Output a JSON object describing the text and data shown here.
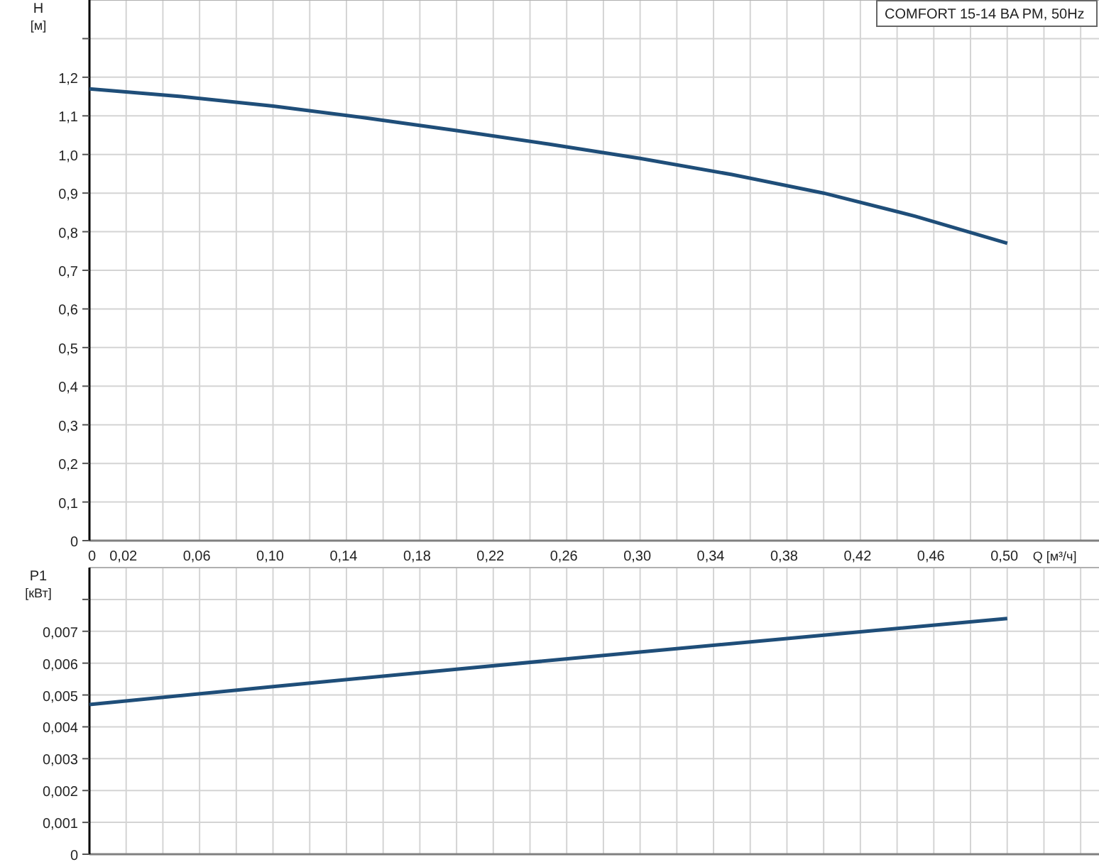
{
  "head_chart": {
    "unit": "[м]",
    "chart_data": {
      "type": "line",
      "grid": true,
      "ylabel": "H",
      "xlabel": "Q [м³/ч]",
      "x": [
        0,
        0.05,
        0.1,
        0.15,
        0.2,
        0.25,
        0.3,
        0.35,
        0.4,
        0.45,
        0.5
      ],
      "series": [
        {
          "name": "COMFORT 15-14 BA PM, 50Hz",
          "color": "#1f4e79",
          "values": [
            1.17,
            1.15,
            1.125,
            1.095,
            1.062,
            1.027,
            0.99,
            0.948,
            0.9,
            0.84,
            0.77
          ]
        }
      ],
      "xlim": [
        0,
        0.55
      ],
      "ylim": [
        0,
        1.4
      ],
      "xticks": [
        {
          "value": 0,
          "label": "0"
        },
        {
          "value": 0.02,
          "label": "0,02"
        },
        {
          "value": 0.06,
          "label": "0,06"
        },
        {
          "value": 0.1,
          "label": "0,10"
        },
        {
          "value": 0.14,
          "label": "0,14"
        },
        {
          "value": 0.18,
          "label": "0,18"
        },
        {
          "value": 0.22,
          "label": "0,22"
        },
        {
          "value": 0.26,
          "label": "0,26"
        },
        {
          "value": 0.3,
          "label": "0,30"
        },
        {
          "value": 0.34,
          "label": "0,34"
        },
        {
          "value": 0.38,
          "label": "0,38"
        },
        {
          "value": 0.42,
          "label": "0,42"
        },
        {
          "value": 0.46,
          "label": "0,46"
        },
        {
          "value": 0.5,
          "label": "0,50"
        }
      ],
      "yticks": [
        {
          "value": 0,
          "label": "0"
        },
        {
          "value": 0.1,
          "label": "0,1"
        },
        {
          "value": 0.2,
          "label": "0,2"
        },
        {
          "value": 0.3,
          "label": "0,3"
        },
        {
          "value": 0.4,
          "label": "0,4"
        },
        {
          "value": 0.5,
          "label": "0,5"
        },
        {
          "value": 0.6,
          "label": "0,6"
        },
        {
          "value": 0.7,
          "label": "0,7"
        },
        {
          "value": 0.8,
          "label": "0,8"
        },
        {
          "value": 0.9,
          "label": "0,9"
        },
        {
          "value": 1.0,
          "label": "1,0"
        },
        {
          "value": 1.1,
          "label": "1,1"
        },
        {
          "value": 1.2,
          "label": "1,2"
        }
      ]
    }
  },
  "power_chart": {
    "unit": "[кВт]",
    "chart_data": {
      "type": "line",
      "grid": true,
      "ylabel": "P1",
      "x": [
        0,
        0.1,
        0.2,
        0.3,
        0.4,
        0.5
      ],
      "series": [
        {
          "color": "#1f4e79",
          "values": [
            0.0047,
            0.00526,
            0.00581,
            0.00635,
            0.00688,
            0.0074
          ]
        }
      ],
      "xlim": [
        0,
        0.55
      ],
      "ylim": [
        0,
        0.009
      ],
      "yticks": [
        {
          "value": 0,
          "label": "0"
        },
        {
          "value": 0.001,
          "label": "0,001"
        },
        {
          "value": 0.002,
          "label": "0,002"
        },
        {
          "value": 0.003,
          "label": "0,003"
        },
        {
          "value": 0.004,
          "label": "0,004"
        },
        {
          "value": 0.005,
          "label": "0,005"
        },
        {
          "value": 0.006,
          "label": "0,006"
        },
        {
          "value": 0.007,
          "label": "0,007"
        }
      ]
    }
  }
}
